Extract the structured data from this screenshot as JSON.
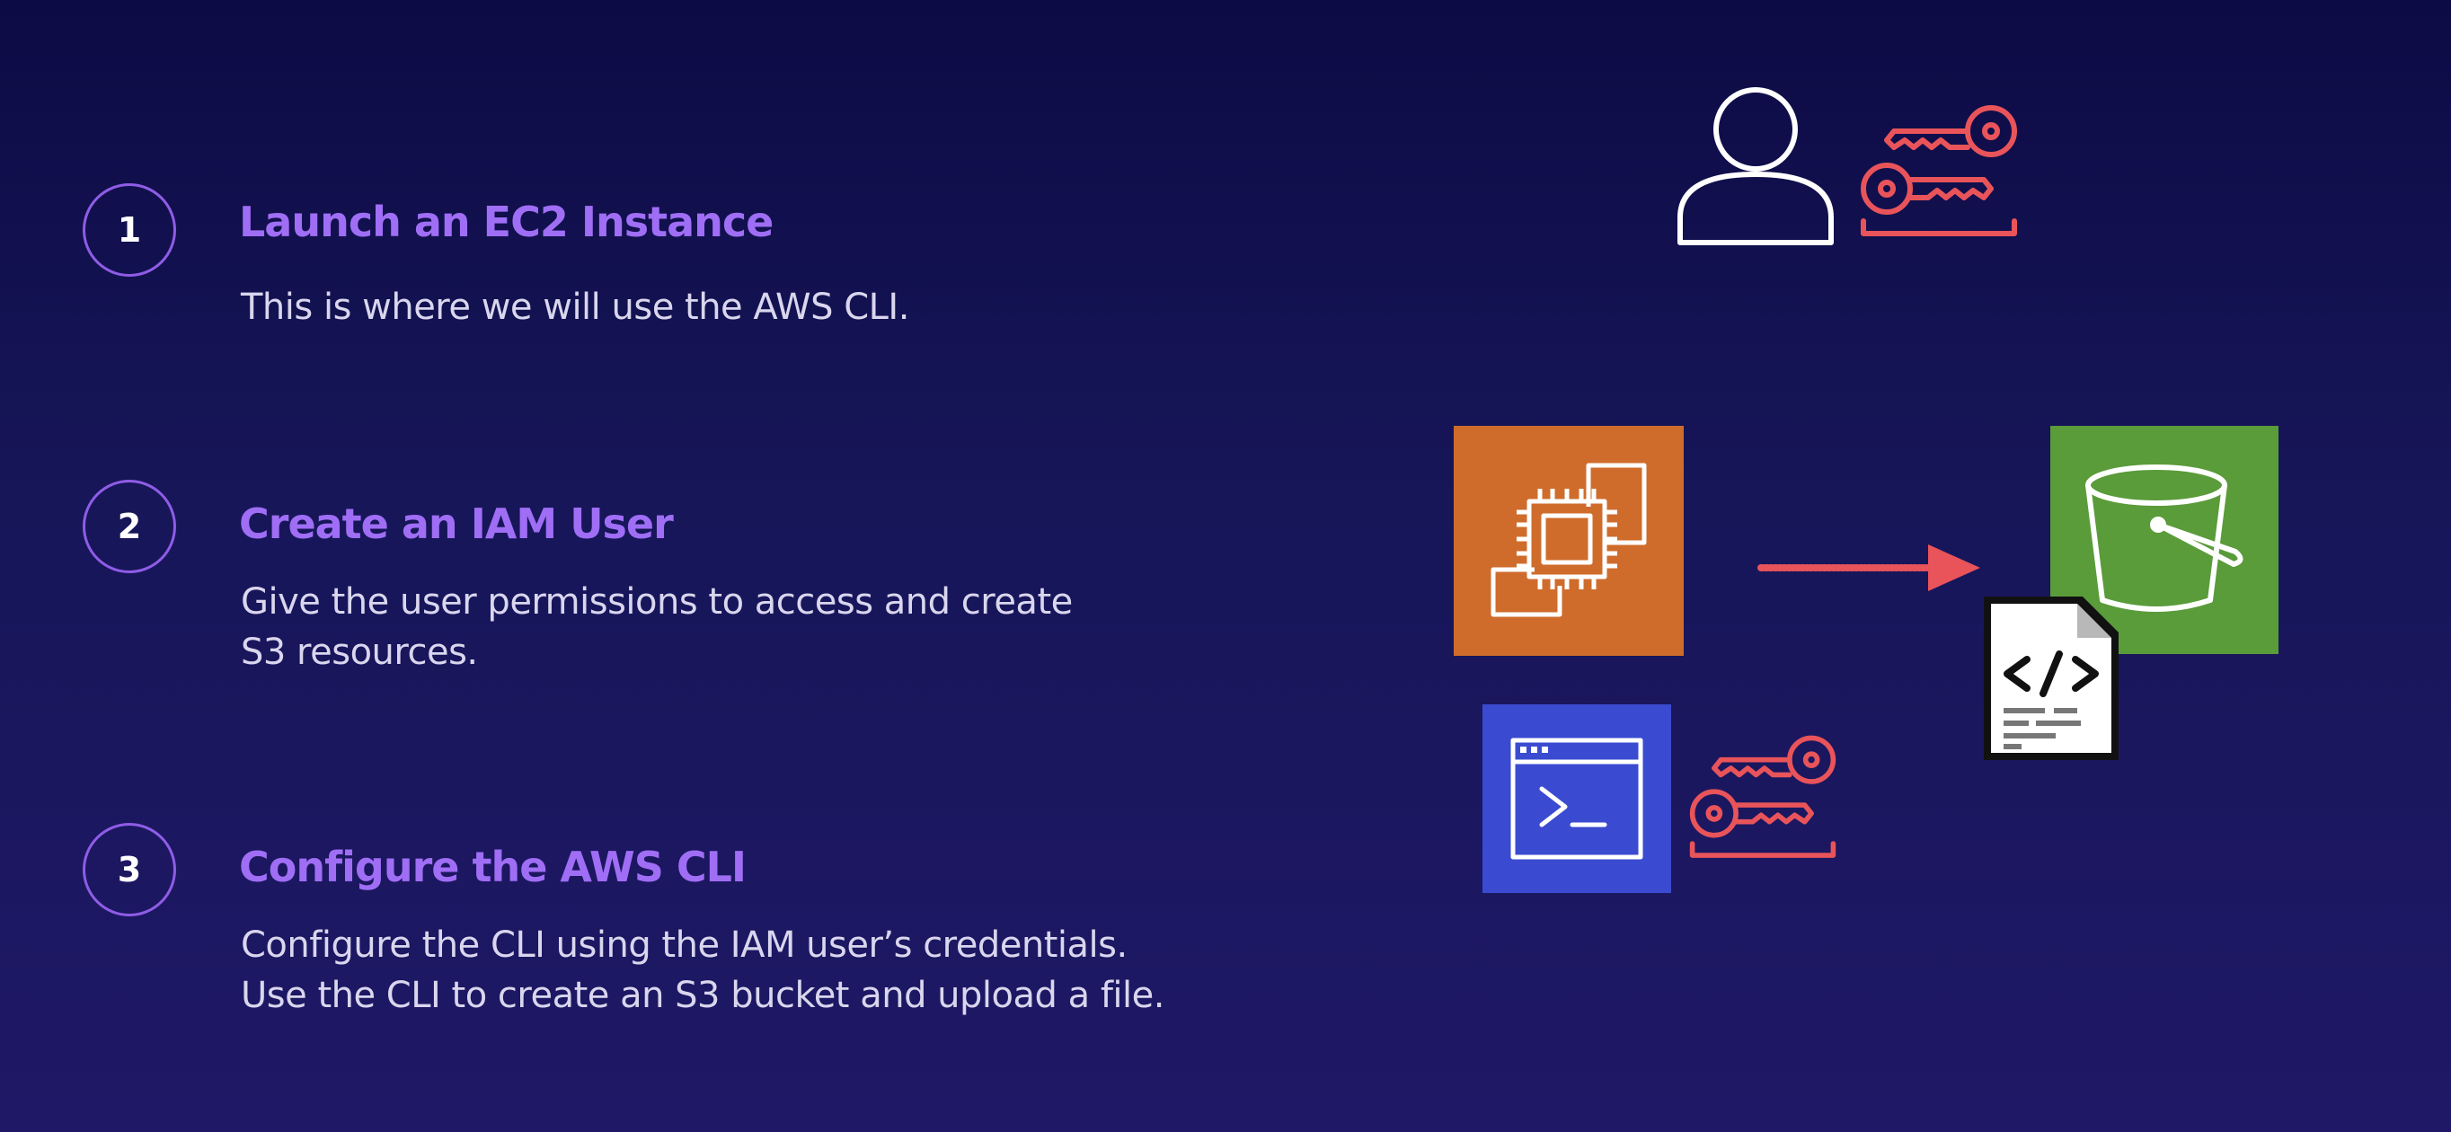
{
  "steps": [
    {
      "number": "1",
      "title": "Launch an EC2 Instance",
      "description_lines": [
        "This is where we will use the AWS CLI."
      ]
    },
    {
      "number": "2",
      "title": "Create an IAM User",
      "description_lines": [
        "Give the user permissions to access and create",
        "S3 resources."
      ]
    },
    {
      "number": "3",
      "title": "Configure the AWS CLI",
      "description_lines": [
        "Configure the CLI using the IAM user’s credentials.",
        "Use the CLI to create an S3 bucket and upload a file."
      ]
    }
  ],
  "diagram": {
    "icons": [
      "user-icon",
      "access-keys-icon",
      "ec2-instance-icon",
      "cli-terminal-icon",
      "s3-bucket-icon",
      "code-file-icon",
      "arrow-icon"
    ],
    "colors": {
      "background": "#151457",
      "accent_purple": "#9f6ef5",
      "key_red": "#e8545a",
      "ec2_orange": "#cf6c2c",
      "cli_blue": "#3a4bd1",
      "s3_green": "#5a9b3a"
    }
  }
}
